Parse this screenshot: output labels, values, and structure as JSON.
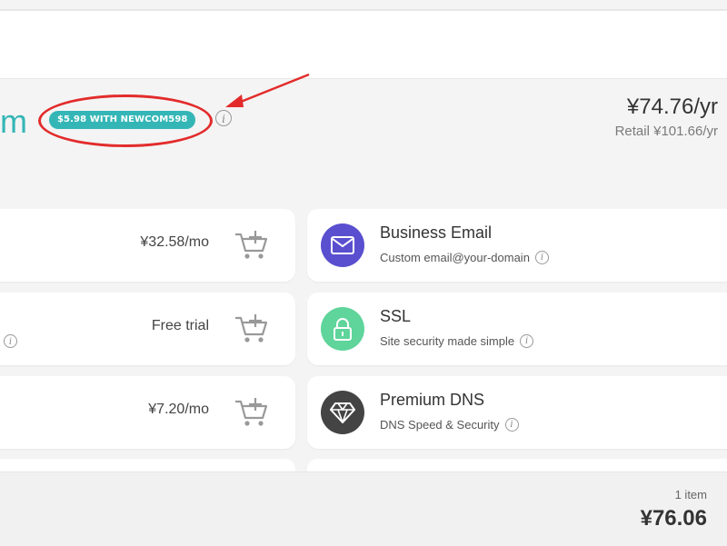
{
  "domain": {
    "name_fragment": "m",
    "promo_label": "$5.98 WITH NEWCOM598",
    "price": "¥74.76/yr",
    "retail": "Retail ¥101.66/yr"
  },
  "addons_left": [
    {
      "price": "¥32.58/mo"
    },
    {
      "price": "Free trial"
    },
    {
      "price": "¥7.20/mo"
    }
  ],
  "addons_right": [
    {
      "title": "Business Email",
      "subtitle": "Custom email@your-domain",
      "icon": "mail-icon",
      "color": "#5a4fcf"
    },
    {
      "title": "SSL",
      "subtitle": "Site security made simple",
      "icon": "lock-icon",
      "color": "#5fd49b"
    },
    {
      "title": "Premium DNS",
      "subtitle": "DNS Speed & Security",
      "icon": "diamond-icon",
      "color": "#444444"
    }
  ],
  "cart": {
    "item_count": "1 item",
    "total": "¥76.06"
  },
  "colors": {
    "accent": "#35b6b6",
    "annotation": "#e32b2b"
  }
}
